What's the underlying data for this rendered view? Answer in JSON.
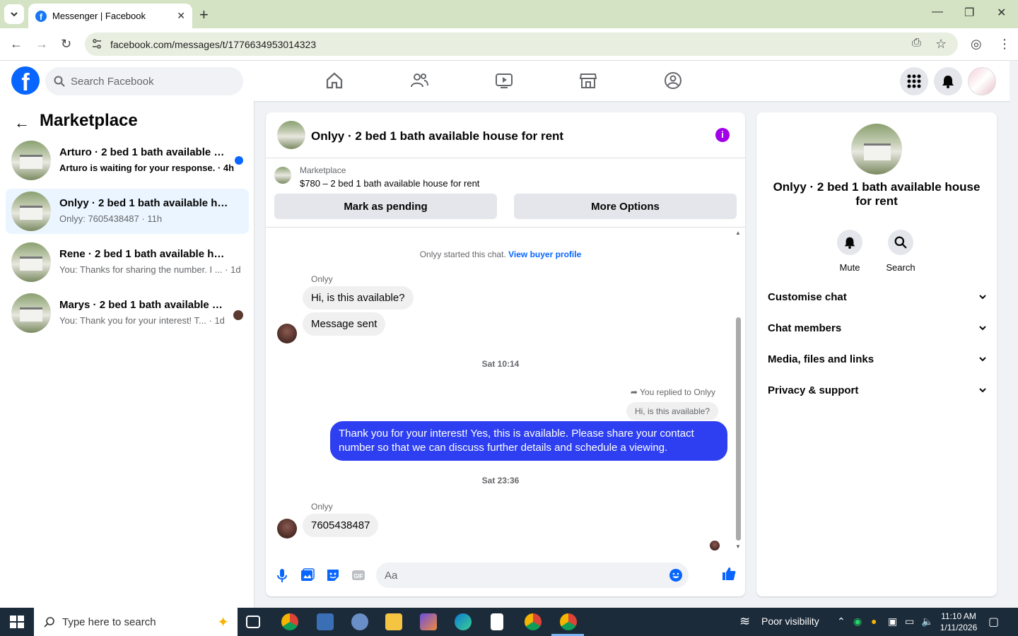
{
  "browser": {
    "tab_title": "Messenger | Facebook",
    "url": "facebook.com/messages/t/1776634953014323"
  },
  "fb": {
    "search_placeholder": "Search Facebook"
  },
  "sidebar": {
    "title": "Marketplace",
    "conversations": [
      {
        "name": "Arturo · 2 bed 1 bath available house for rent",
        "preview": "Arturo is waiting for your response.",
        "time": "· 4h",
        "unread": true
      },
      {
        "name": "Onlyy · 2 bed 1 bath available house for rent",
        "preview": "Onlyy: 7605438487",
        "time": "· 11h",
        "unread": false
      },
      {
        "name": "Rene · 2 bed 1 bath available house for rent",
        "preview": "You: Thanks for sharing the number. I ...",
        "time": "· 1d",
        "unread": false
      },
      {
        "name": "Marys · 2 bed 1 bath available house for rent",
        "preview": "You: Thank you for your interest! T...",
        "time": "· 1d",
        "unread": false
      }
    ]
  },
  "chat": {
    "title": "Onlyy · 2 bed 1 bath available house for rent",
    "marketplace_label": "Marketplace",
    "listing": "$780 – 2 bed 1 bath available house for rent",
    "btn_pending": "Mark as pending",
    "btn_more": "More Options",
    "started": "Onlyy started this chat.",
    "view_profile": "View buyer profile",
    "sender1": "Onlyy",
    "msg1": "Hi, is this available?",
    "msg2": "Message sent",
    "time1": "Sat 10:14",
    "replied": "You replied to Onlyy",
    "quote": "Hi, is this available?",
    "my_msg": "Thank you for your interest! Yes, this is available. Please share your contact number so that we can discuss further details and schedule a viewing.",
    "time2": "Sat 23:36",
    "sender2": "Onlyy",
    "msg3": "7605438487",
    "composer_placeholder": "Aa"
  },
  "rpanel": {
    "name": "Onlyy · 2 bed 1 bath available house for rent",
    "mute": "Mute",
    "search": "Search",
    "sections": [
      "Customise chat",
      "Chat members",
      "Media, files and links",
      "Privacy & support"
    ]
  },
  "taskbar": {
    "search": "Type here to search",
    "weather": "Poor visibility",
    "time": "11:10 AM",
    "date": "1/11/2026"
  }
}
